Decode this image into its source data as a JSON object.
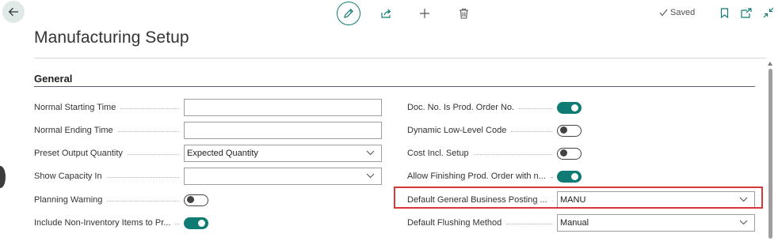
{
  "toolbar": {
    "saved_label": "Saved"
  },
  "page": {
    "title": "Manufacturing Setup",
    "section": "General"
  },
  "left_fields": [
    {
      "label": "Normal Starting Time",
      "type": "text",
      "value": ""
    },
    {
      "label": "Normal Ending Time",
      "type": "text",
      "value": ""
    },
    {
      "label": "Preset Output Quantity",
      "type": "select",
      "value": "Expected Quantity"
    },
    {
      "label": "Show Capacity In",
      "type": "select",
      "value": ""
    },
    {
      "label": "Planning Warning",
      "type": "toggle",
      "on": false
    },
    {
      "label": "Include Non-Inventory Items to Pr...",
      "type": "toggle",
      "on": true
    }
  ],
  "right_fields": [
    {
      "label": "Doc. No. Is Prod. Order No.",
      "type": "toggle",
      "on": true
    },
    {
      "label": "Dynamic Low-Level Code",
      "type": "toggle",
      "on": false
    },
    {
      "label": "Cost Incl. Setup",
      "type": "toggle",
      "on": false
    },
    {
      "label": "Allow Finishing Prod. Order with n...",
      "type": "toggle",
      "on": true
    },
    {
      "label": "Default General Business Posting ...",
      "type": "select",
      "value": "MANU"
    },
    {
      "label": "Default Flushing Method",
      "type": "select",
      "value": "Manual"
    }
  ],
  "colors": {
    "accent": "#0f7b72",
    "highlight": "#d9383b"
  }
}
